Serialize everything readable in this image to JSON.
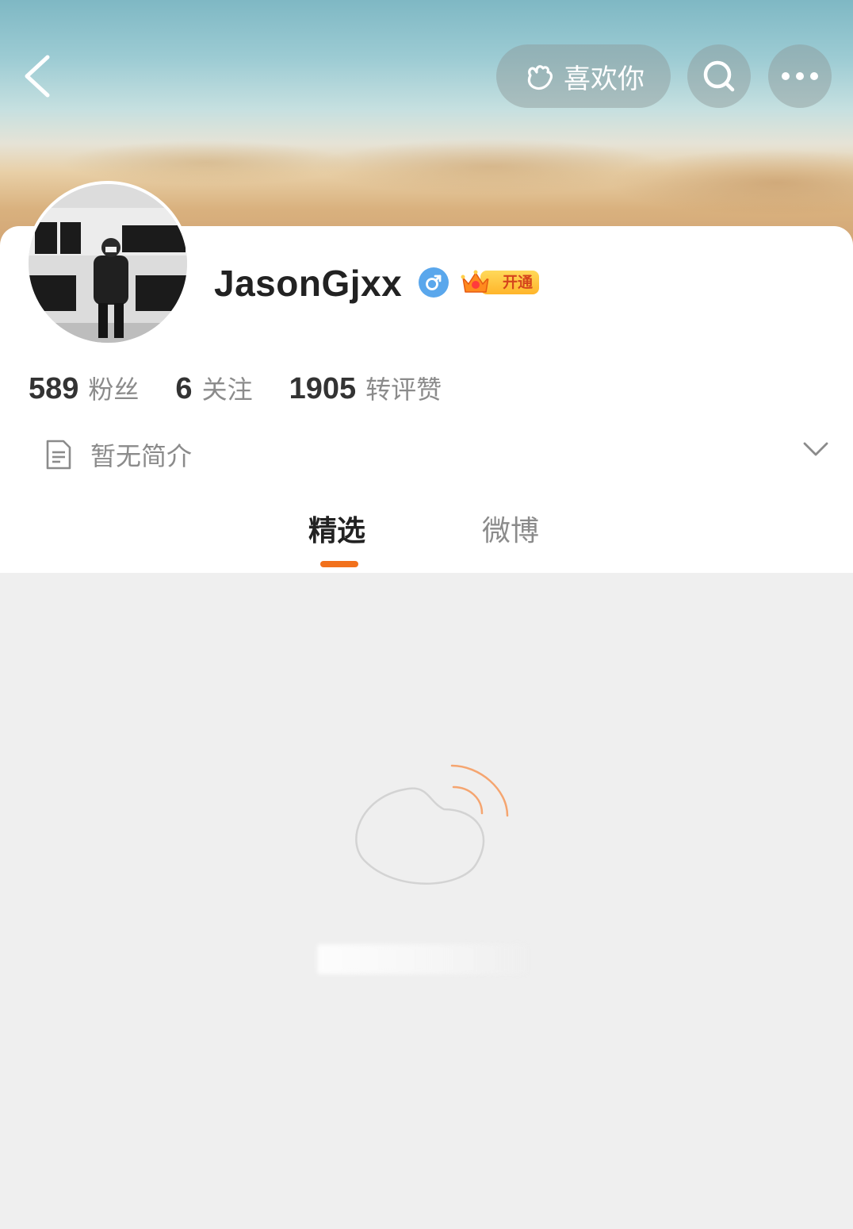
{
  "header": {
    "like_label": "喜欢你"
  },
  "profile": {
    "username": "JasonGjxx",
    "gender_symbol": "♂",
    "vip_label": "开通",
    "stats": [
      {
        "value": "589",
        "label": "粉丝"
      },
      {
        "value": "6",
        "label": "关注"
      },
      {
        "value": "1905",
        "label": "转评赞"
      }
    ],
    "bio": "暂无简介"
  },
  "tabs": [
    {
      "label": "精选",
      "active": true
    },
    {
      "label": "微博",
      "active": false
    }
  ],
  "colors": {
    "accent": "#f2711c",
    "gender_badge": "#5aa7ec",
    "vip_gold": "#ffc53d",
    "text_primary": "#222222",
    "text_secondary": "#8b8b8b"
  }
}
